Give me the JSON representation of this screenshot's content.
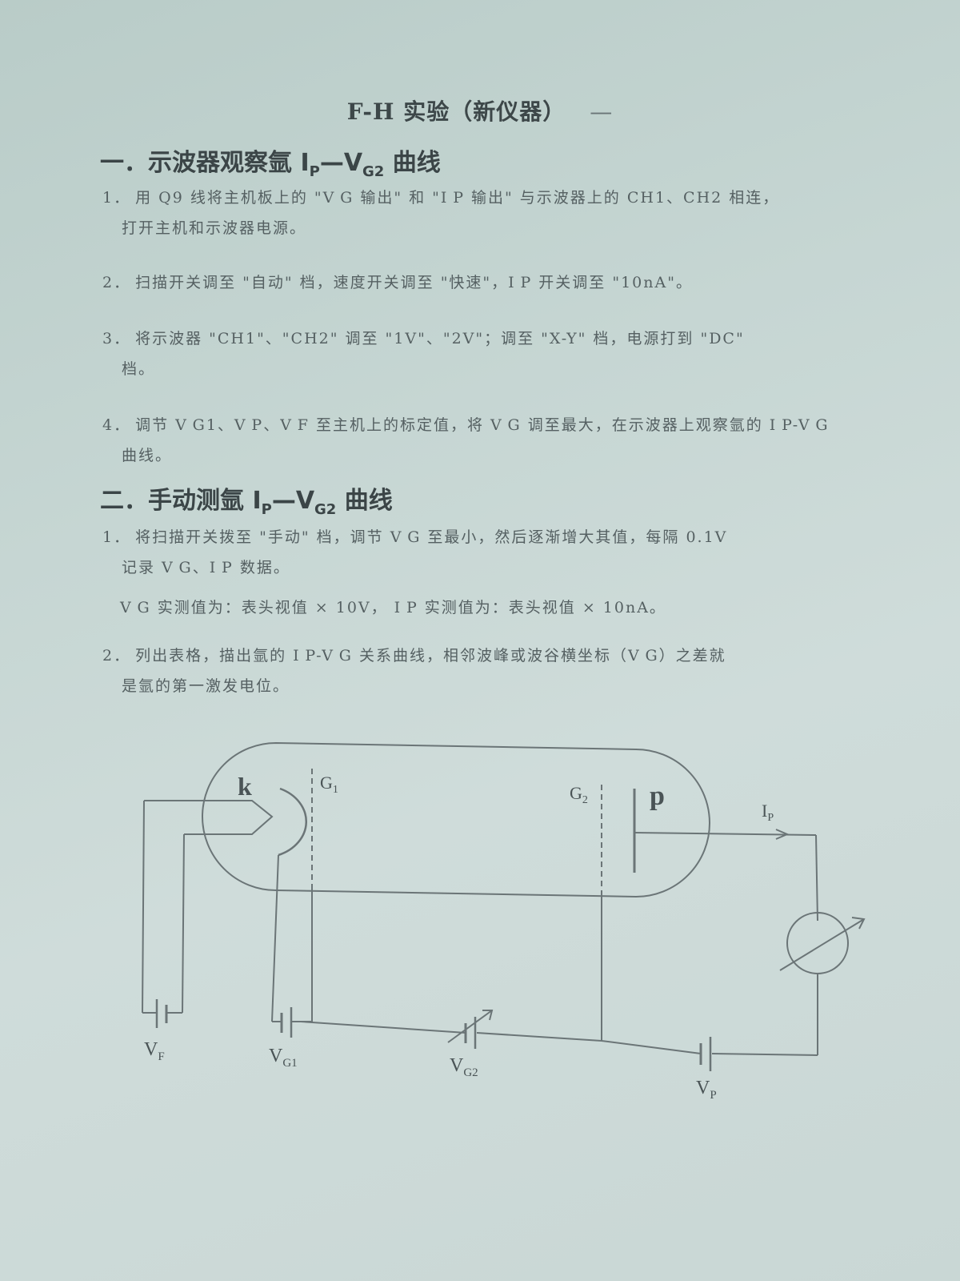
{
  "title": "F-H 实验（新仪器）",
  "title_trail": "—",
  "section1": {
    "heading_prefix": "一．示波器观察氩 I",
    "heading_sub1": "P",
    "heading_mid": "—V",
    "heading_sub2": "G2",
    "heading_suffix": " 曲线",
    "steps": [
      {
        "num": "1．",
        "line1": "用 Q9 线将主机板上的 \"V G 输出\" 和 \"I P 输出\" 与示波器上的 CH1、CH2 相连，",
        "line2": "打开主机和示波器电源。"
      },
      {
        "num": "2．",
        "line1": "扫描开关调至 \"自动\" 档，速度开关调至 \"快速\"，I P 开关调至 \"10nA\"。"
      },
      {
        "num": "3．",
        "line1": "将示波器 \"CH1\"、\"CH2\" 调至 \"1V\"、\"2V\"；调至 \"X-Y\" 档，电源打到 \"DC\"",
        "line2": "档。"
      },
      {
        "num": "4．",
        "line1": "调节 V G1、V P、V F 至主机上的标定值，将 V G 调至最大，在示波器上观察氩的 I P-V G",
        "line2": "曲线。"
      }
    ]
  },
  "section2": {
    "heading_prefix": "二．手动测氩 I",
    "heading_sub1": "P",
    "heading_mid": "—V",
    "heading_sub2": "G2",
    "heading_suffix": " 曲线",
    "steps": [
      {
        "num": "1．",
        "line1": "将扫描开关拨至 \"手动\" 档，调节 V G 至最小，然后逐渐增大其值，每隔 0.1V",
        "line2": "记录 V G、I P 数据。"
      },
      {
        "num": "",
        "line1": "V G 实测值为：表头视值 × 10V，   I P 实测值为：表头视值 × 10nA。"
      },
      {
        "num": "2．",
        "line1": "列出表格，描出氩的 I P-V G 关系曲线，相邻波峰或波谷横坐标（V G）之差就",
        "line2": "是氩的第一激发电位。"
      }
    ]
  },
  "diagram": {
    "label_k": "k",
    "label_g1": "G",
    "label_g1_sub": "1",
    "label_g2": "G",
    "label_g2_sub": "2",
    "label_p": "p",
    "label_ip": "I",
    "label_ip_sub": "P",
    "label_vf": "V",
    "label_vf_sub": "F",
    "label_vg1": "V",
    "label_vg1_sub": "G1",
    "label_vg2": "V",
    "label_vg2_sub": "G2",
    "label_vp": "V",
    "label_vp_sub": "P"
  }
}
